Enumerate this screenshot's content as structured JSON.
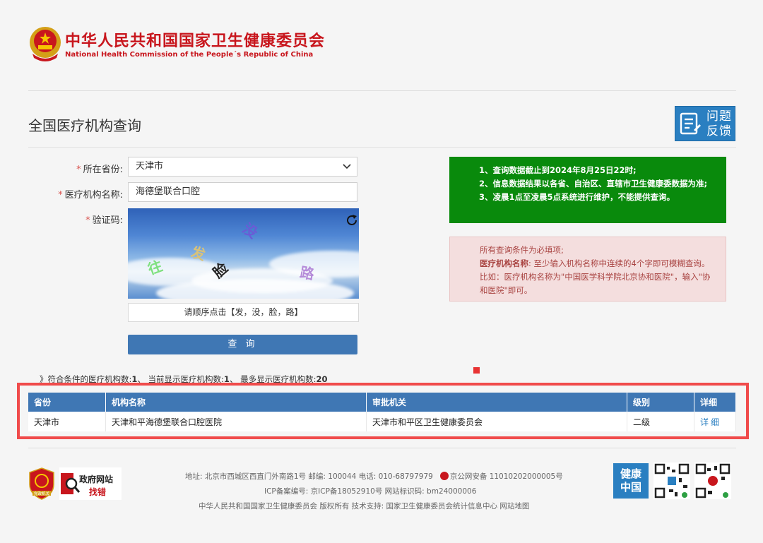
{
  "header": {
    "title_cn": "中华人民共和国国家卫生健康委员会",
    "title_en": "National Health Commission of the People´s Republic of China"
  },
  "page": {
    "title": "全国医疗机构查询",
    "feedback_line1": "问题",
    "feedback_line2": "反馈"
  },
  "form": {
    "required_mark": "*",
    "province_label": "所在省份:",
    "province_value": "天津市",
    "name_label": "医疗机构名称:",
    "name_value": "海德堡联合口腔",
    "captcha_label": "验证码:",
    "captcha_chars": [
      "往",
      "发",
      "没",
      "脸",
      "路"
    ],
    "captcha_hint": "请顺序点击【发，没，脸，路】",
    "query_button": "查 询"
  },
  "notice_green": {
    "line1": "1、查询数据截止到2024年8月25日22时;",
    "line2": "2、信息数据结果以各省、自治区、直辖市卫生健康委数据为准;",
    "line3": "3、凌晨1点至凌晨5点系统进行维护，不能提供查询。"
  },
  "notice_red": {
    "line1": "所有查询条件为必填项;",
    "label": "医疗机构名称",
    "text": ": 至少输入机构名称中连续的4个字即可模糊查询。比如：医疗机构名称为\"中国医学科学院北京协和医院\"，输入\"协和医院\"即可。"
  },
  "summary": {
    "prefix": "》符合条件的医疗机构数:",
    "match_count": "1",
    "sep1": "、 当前显示医疗机构数:",
    "shown_count": "1",
    "sep2": "、 最多显示医疗机构数:",
    "max_count": "20"
  },
  "table": {
    "headers": [
      "省份",
      "机构名称",
      "审批机关",
      "级别",
      "详细"
    ],
    "rows": [
      {
        "province": "天津市",
        "name": "天津和平海德堡联合口腔医院",
        "authority": "天津市和平区卫生健康委员会",
        "level": "二级",
        "detail": "详细"
      }
    ]
  },
  "footer": {
    "line1": "地址: 北京市西城区西直门外南路1号    邮编: 100044    电话: 010-68797979",
    "police": "京公网安备 11010202000005号",
    "line2": "ICP备案编号: 京ICP备18052910号    网站标识码: bm24000006",
    "line3": "中华人民共和国国家卫生健康委员会    版权所有    技术支持: 国家卫生健康委员会统计信息中心    网站地图",
    "gov_badge_top": "政府网站",
    "gov_badge_bottom": "找错",
    "shield_text": "党政机关",
    "health_logo_line1": "健康",
    "health_logo_line2": "中国"
  },
  "colors": {
    "brand_red": "#c8161d",
    "primary_blue": "#3f77b4",
    "notice_green": "#098a0c",
    "notice_red_bg": "#f4dede",
    "highlight_red": "#f04b4b"
  }
}
